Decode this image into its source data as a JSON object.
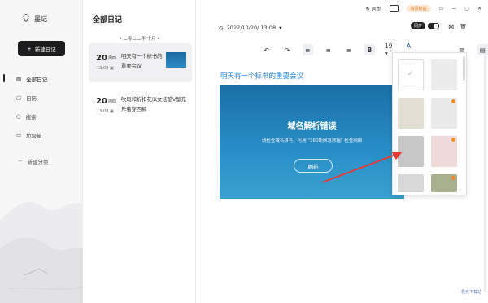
{
  "app": {
    "name": "墨记",
    "new_button": "新建日记"
  },
  "sidebar": {
    "items": [
      {
        "label": "全部日记…",
        "icon": "book-icon"
      },
      {
        "label": "日历",
        "icon": "calendar-icon"
      },
      {
        "label": "搜索",
        "icon": "search-icon"
      },
      {
        "label": "垃圾箱",
        "icon": "trash-icon"
      }
    ],
    "add_category": "新建分类"
  },
  "list": {
    "title": "全部日记",
    "month_separator": "二零二二年 十月",
    "entries": [
      {
        "day": "20",
        "weekday": "周四",
        "time": "13:08",
        "title": "明天有一个标书的重要会议",
        "has_thumb": true
      },
      {
        "day": "20",
        "weekday": "周四",
        "time": "13:08",
        "title": "吹风和折扣花似女炫酷V型充斥着穿西裤",
        "has_thumb": false
      }
    ]
  },
  "editor": {
    "date": "2022/10/20/ 13:08",
    "sync_label": "同步",
    "vip_label": "会员权益",
    "toggle_label": "同步",
    "font_size": "19",
    "doc_title": "明天有一个标书的重要会议",
    "banner": {
      "heading": "域名解析错误",
      "desc": "请检查域名拼写，可用 \"360断网急救箱\" 检查网络",
      "button": "刷新"
    }
  },
  "popup": {
    "swatches": [
      {
        "color": "#ffffff",
        "selected": true
      },
      {
        "color": "#ececec",
        "selected": false
      },
      {
        "color": "#e3ded2",
        "selected": false
      },
      {
        "color": "#e9e9e9",
        "selected": false
      },
      {
        "color": "#c6c6c6",
        "selected": false
      },
      {
        "color": "#efdada",
        "selected": false
      },
      {
        "color": "#d9d9d9",
        "selected": false
      },
      {
        "color": "#a9b08e",
        "selected": false
      }
    ],
    "vip_badge_color": "#f08a24"
  },
  "colors": {
    "accent": "#2c8be0",
    "arrow": "#e53935",
    "dark_button": "#1d1d1f"
  },
  "watermark": "极光下载站"
}
